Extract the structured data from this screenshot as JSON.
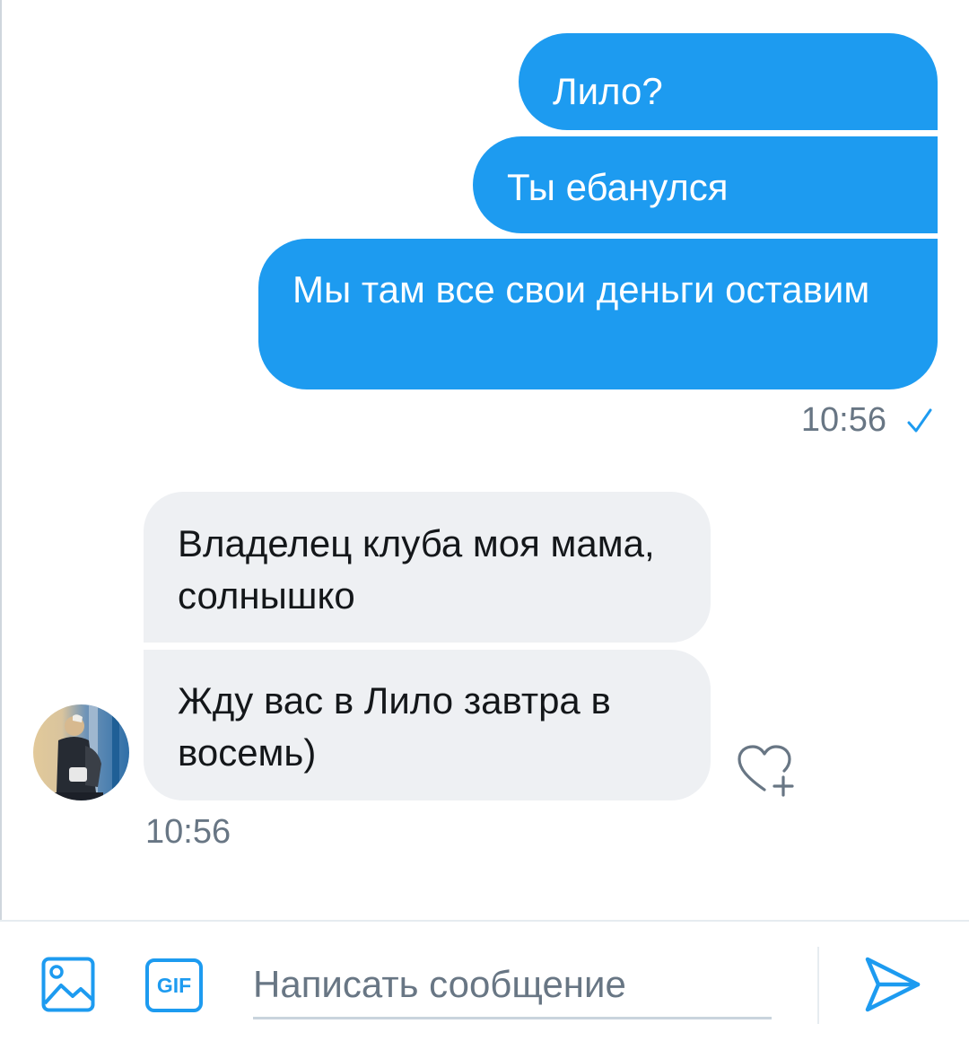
{
  "colors": {
    "accent": "#1d9bf0",
    "incoming_bubble": "#eef0f3",
    "secondary_text": "#687684"
  },
  "outgoing": {
    "messages": [
      "Лило?",
      "Ты ебанулся",
      "Мы там все свои деньги оставим"
    ],
    "time": "10:56",
    "status_icon": "check-icon"
  },
  "incoming": {
    "messages": [
      "Владелец клуба моя мама, солнышко",
      "Жду вас в Лило завтра в восемь)"
    ],
    "time": "10:56",
    "reaction_icon": "heart-plus-icon"
  },
  "composer": {
    "image_icon": "image-icon",
    "gif_label": "GIF",
    "input_placeholder": "Написать сообщение",
    "input_value": "",
    "send_icon": "send-icon"
  }
}
